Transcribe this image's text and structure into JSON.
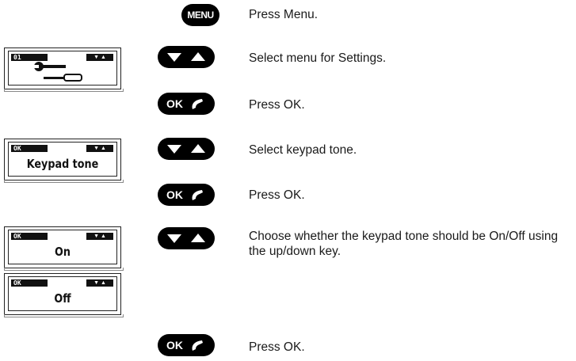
{
  "keys": {
    "menu_label": "MENU",
    "ok_label": "OK",
    "nav_icon": "up-down-arrow-key",
    "ok_icon": "phone-handset-icon"
  },
  "displays": [
    {
      "tag": "01",
      "icon": "wrench-settings-icon",
      "text": ""
    },
    {
      "tag": "OK",
      "text": "Keypad tone"
    },
    {
      "tag": "OK",
      "text": "On"
    },
    {
      "tag": "OK",
      "text": "Off"
    }
  ],
  "steps": [
    "Press Menu.",
    "Select menu for Settings.",
    "Press OK.",
    "Select keypad tone.",
    "Press OK.",
    "Choose whether the keypad tone should be On/Off using the up/down key.",
    "Press OK."
  ]
}
